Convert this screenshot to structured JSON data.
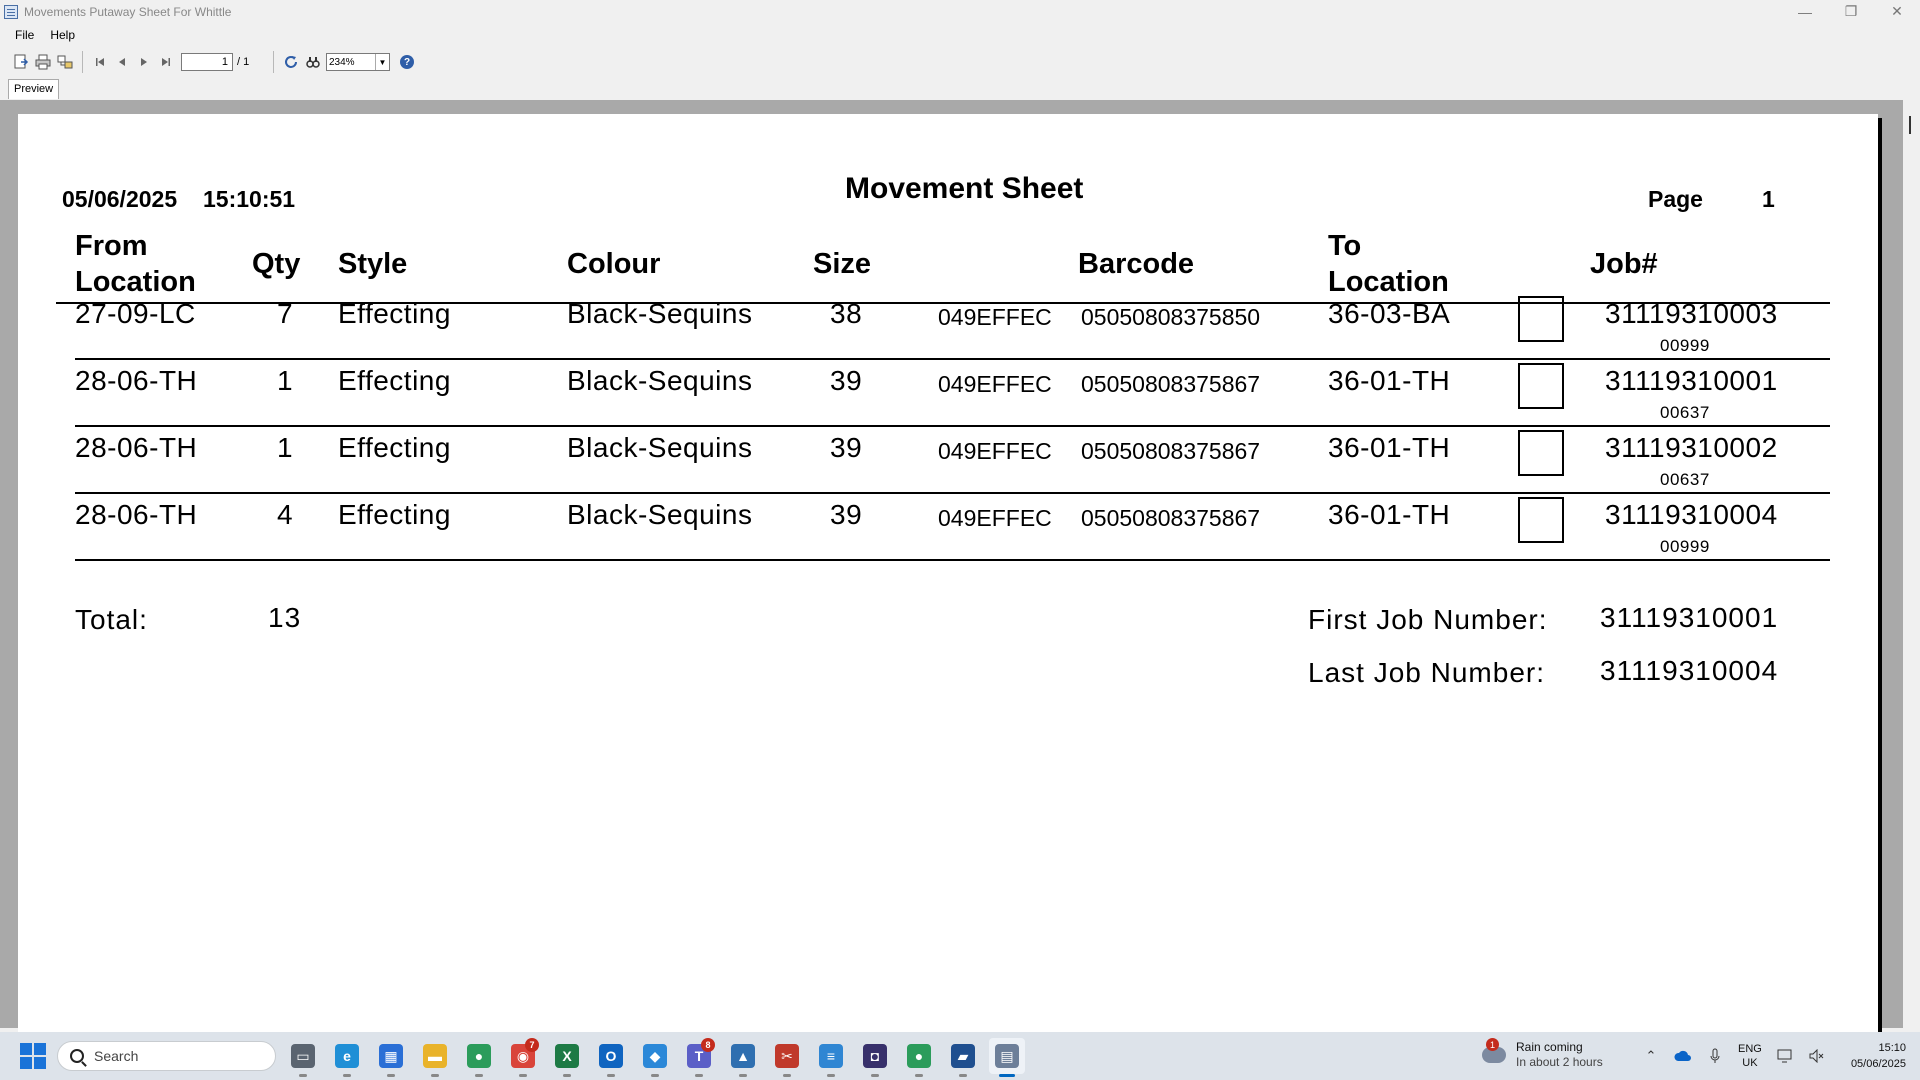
{
  "window": {
    "title": "Movements Putaway Sheet For Whittle",
    "minimize_glyph": "—",
    "restore_glyph": "❐",
    "close_glyph": "✕"
  },
  "menu": {
    "file": "File",
    "help": "Help"
  },
  "toolbar": {
    "page_current": "1",
    "page_total": "/ 1",
    "zoom": "234%",
    "icons": [
      "export-icon",
      "print-icon",
      "print-setup-icon",
      "first-page-icon",
      "prev-page-icon",
      "next-page-icon",
      "last-page-icon",
      "refresh-icon",
      "find-icon",
      "help-icon"
    ]
  },
  "tabs": {
    "preview": "Preview"
  },
  "report": {
    "date": "05/06/2025",
    "time": "15:10:51",
    "title": "Movement Sheet",
    "page_label": "Page",
    "page_number": "1",
    "headers": {
      "from_line1": "From",
      "from_line2": "Location",
      "qty": "Qty",
      "style": "Style",
      "colour": "Colour",
      "size": "Size",
      "barcode": "Barcode",
      "to_line1": "To",
      "to_line2": "Location",
      "job": "Job#"
    },
    "rows": [
      {
        "from": "27-09-LC",
        "qty": "7",
        "style": "Effecting",
        "colour": "Black-Sequins",
        "size": "38",
        "code": "049EFFEC",
        "barcode": "05050808375850",
        "to": "36-03-BA",
        "job": "31119310003",
        "job_sub": "00999"
      },
      {
        "from": "28-06-TH",
        "qty": "1",
        "style": "Effecting",
        "colour": "Black-Sequins",
        "size": "39",
        "code": "049EFFEC",
        "barcode": "05050808375867",
        "to": "36-01-TH",
        "job": "31119310001",
        "job_sub": "00637"
      },
      {
        "from": "28-06-TH",
        "qty": "1",
        "style": "Effecting",
        "colour": "Black-Sequins",
        "size": "39",
        "code": "049EFFEC",
        "barcode": "05050808375867",
        "to": "36-01-TH",
        "job": "31119310002",
        "job_sub": "00637"
      },
      {
        "from": "28-06-TH",
        "qty": "4",
        "style": "Effecting",
        "colour": "Black-Sequins",
        "size": "39",
        "code": "049EFFEC",
        "barcode": "05050808375867",
        "to": "36-01-TH",
        "job": "31119310004",
        "job_sub": "00999"
      }
    ],
    "total_label": "Total:",
    "total_value": "13",
    "first_job_label": "First Job Number:",
    "first_job_value": "31119310001",
    "last_job_label": "Last Job Number:",
    "last_job_value": "31119310004"
  },
  "taskbar": {
    "search_placeholder": "Search",
    "apps": [
      {
        "name": "task-view",
        "color": "#5a6470",
        "glyph": "▭"
      },
      {
        "name": "edge",
        "color": "#1f8fd6",
        "glyph": "e"
      },
      {
        "name": "store",
        "color": "#2a6fd6",
        "glyph": "▦"
      },
      {
        "name": "file-explorer",
        "color": "#e9b32a",
        "glyph": "▬"
      },
      {
        "name": "search-tool",
        "color": "#2b9c5b",
        "glyph": "●"
      },
      {
        "name": "chrome",
        "color": "#d9443a",
        "glyph": "◉",
        "badge": "7"
      },
      {
        "name": "excel",
        "color": "#1d7a45",
        "glyph": "X"
      },
      {
        "name": "outlook",
        "color": "#0f64c0",
        "glyph": "O"
      },
      {
        "name": "vscode",
        "color": "#2b88d8",
        "glyph": "◆"
      },
      {
        "name": "teams",
        "color": "#5b5fc7",
        "glyph": "T",
        "badge": "8"
      },
      {
        "name": "monitor",
        "color": "#2f6fb0",
        "glyph": "▲"
      },
      {
        "name": "snipping",
        "color": "#c0392b",
        "glyph": "✂"
      },
      {
        "name": "notepad",
        "color": "#2f86d3",
        "glyph": "≡"
      },
      {
        "name": "camera-app",
        "color": "#37306b",
        "glyph": "◘"
      },
      {
        "name": "search-tool-2",
        "color": "#2b9c5b",
        "glyph": "●"
      },
      {
        "name": "remote",
        "color": "#1f4f8f",
        "glyph": "▰"
      },
      {
        "name": "report-viewer",
        "color": "#6d7f99",
        "glyph": "▤",
        "active": true
      }
    ],
    "weather_badge": "1",
    "weather_title": "Rain coming",
    "weather_sub": "In about 2 hours",
    "lang_line1": "ENG",
    "lang_line2": "UK",
    "clock_time": "15:10",
    "clock_date": "05/06/2025"
  }
}
